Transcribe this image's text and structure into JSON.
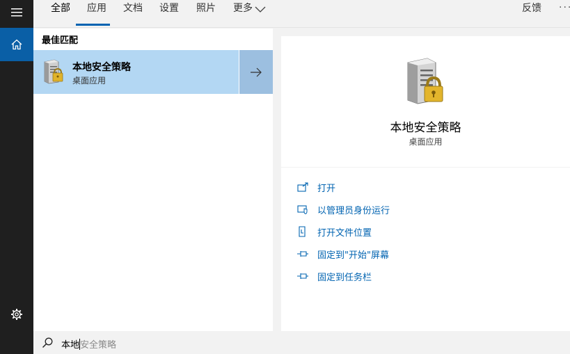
{
  "tabs": [
    {
      "label": "全部",
      "active": true
    },
    {
      "label": "应用"
    },
    {
      "label": "文档"
    },
    {
      "label": "设置"
    },
    {
      "label": "照片"
    },
    {
      "label": "更多"
    }
  ],
  "header": {
    "feedback": "反馈",
    "more_options": "···"
  },
  "best_match": {
    "section_label": "最佳匹配",
    "title": "本地安全策略",
    "subtitle": "桌面应用"
  },
  "preview": {
    "name": "本地安全策略",
    "type": "桌面应用"
  },
  "actions": [
    {
      "label": "打开",
      "icon": "open-icon"
    },
    {
      "label": "以管理员身份运行",
      "icon": "shield-admin-icon"
    },
    {
      "label": "打开文件位置",
      "icon": "file-location-icon"
    },
    {
      "label": "固定到\"开始\"屏幕",
      "icon": "pin-icon"
    },
    {
      "label": "固定到任务栏",
      "icon": "pin-icon"
    }
  ],
  "search": {
    "typed": "本地",
    "suggestion": "安全策略"
  },
  "colors": {
    "accent": "#0063b1",
    "selected_row": "#b3d7f3",
    "rail": "#1f1f1f",
    "home": "#0a5fa6"
  }
}
